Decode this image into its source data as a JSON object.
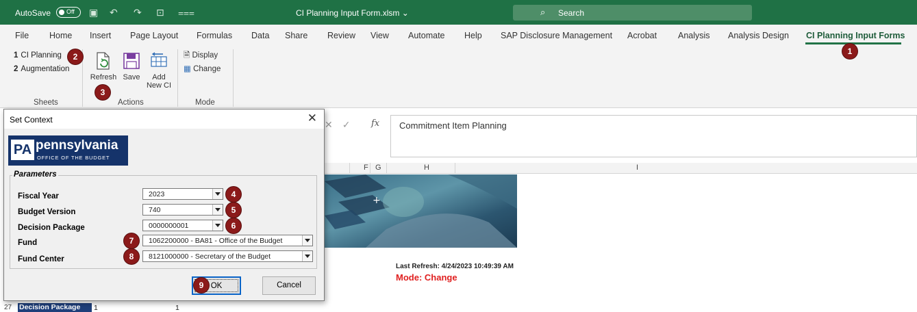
{
  "titlebar": {
    "autosave_label": "AutoSave",
    "autosave_state": "Off",
    "doc_title": "CI Planning Input Form.xlsm ⌄",
    "search_placeholder": "Search"
  },
  "ribbon_tabs": [
    "File",
    "Home",
    "Insert",
    "Page Layout",
    "Formulas",
    "Data",
    "Share",
    "Review",
    "View",
    "Automate",
    "Help",
    "SAP Disclosure Management",
    "Acrobat",
    "Analysis",
    "Analysis Design",
    "CI Planning Input Forms"
  ],
  "active_tab": "CI Planning Input Forms",
  "ribbon": {
    "sheets": {
      "items": [
        {
          "num": "1",
          "label": "CI Planning"
        },
        {
          "num": "2",
          "label": "Augmentation"
        }
      ],
      "group_label": "Sheets"
    },
    "actions": {
      "refresh_label": "Refresh",
      "save_label": "Save",
      "add_line1": "Add",
      "add_line2": "New CI",
      "group_label": "Actions"
    },
    "mode": {
      "display_label": "Display",
      "change_label": "Change",
      "group_label": "Mode"
    }
  },
  "formula_bar": {
    "fx": "fx",
    "formula": "Commitment Item Planning"
  },
  "columns": [
    "F",
    "G",
    "H",
    "I"
  ],
  "sheet": {
    "last_refresh": "Last Refresh: 4/24/2023 10:49:39 AM",
    "mode_text": "Mode: Change",
    "row_number": "27",
    "decision_package_label": "Decision Package",
    "value1": "1",
    "value2": "1"
  },
  "dialog": {
    "title": "Set Context",
    "close": "✕",
    "logo_pa": "PA",
    "logo_name": "pennsylvania",
    "logo_sub": "OFFICE OF THE BUDGET",
    "parameters_legend": "Parameters",
    "fiscal_year_label": "Fiscal Year",
    "fiscal_year_value": "2023",
    "budget_version_label": "Budget Version",
    "budget_version_value": "740",
    "decision_package_label": "Decision Package",
    "decision_package_value": "0000000001",
    "fund_label": "Fund",
    "fund_value": "1062200000 - BA81 - Office of the Budget",
    "fund_center_label": "Fund Center",
    "fund_center_value": "8121000000 - Secretary of the Budget",
    "ok_label": "OK",
    "cancel_label": "Cancel"
  },
  "badges": [
    "1",
    "2",
    "3",
    "4",
    "5",
    "6",
    "7",
    "8",
    "9"
  ],
  "colors": {
    "excel_green": "#1f7145",
    "badge": "#8b1a1a",
    "mode_red": "#e02020",
    "pa_blue": "#15336a"
  }
}
